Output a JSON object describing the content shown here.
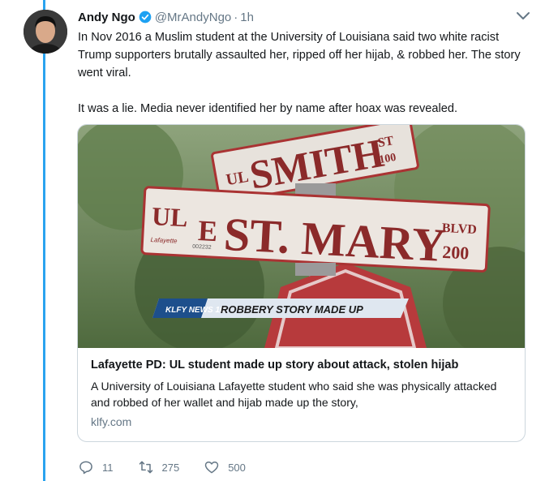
{
  "tweet": {
    "author_name": "Andy Ngo",
    "handle": "@MrAndyNgo",
    "separator": "·",
    "time": "1h",
    "text": "In Nov 2016 a Muslim student at the University of Louisiana said two white racist Trump supporters brutally assaulted her, ripped off her hijab, & robbed her. The story went viral.\n\nIt was a lie. Media never identified her by name after hoax was revealed."
  },
  "card": {
    "title": "Lafayette PD: UL student made up story about attack, stolen hijab",
    "description": "A University of Louisiana Lafayette student who said she was physically attacked and robbed of her wallet and hijab made up the story,",
    "domain": "klfy.com",
    "image": {
      "sign_top_prefix": "UL",
      "sign_top_main": "SMITH",
      "sign_top_suffix": "ST",
      "sign_top_number": "100",
      "sign_main_prefix": "UL",
      "sign_main_small": "Lafayette",
      "sign_main_e": "E",
      "sign_main_main": "ST. MARY",
      "sign_main_suffix": "BLVD",
      "sign_main_number": "200",
      "sign_main_tag": "002232",
      "news_logo": "KLFY NEWS 10",
      "news_banner": "ROBBERY STORY MADE UP"
    }
  },
  "actions": {
    "replies": "11",
    "retweets": "275",
    "likes": "500"
  },
  "colors": {
    "thread_line": "#2aa3ef",
    "verified": "#1da1f2",
    "muted": "#657786"
  }
}
